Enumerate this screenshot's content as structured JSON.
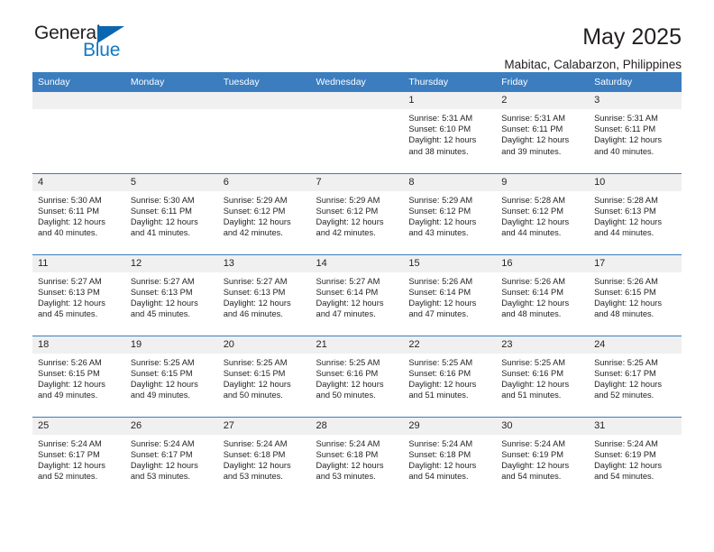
{
  "logo": {
    "word_one": "General",
    "word_two": "Blue",
    "triangle": "blue-triangle-icon",
    "accent": "#1279c1",
    "triangle_color": "#0a66ae"
  },
  "header": {
    "title": "May 2025",
    "subtitle": "Mabitac, Calabarzon, Philippines"
  },
  "theme": {
    "header_band": "#3b7dbf",
    "daynum_band": "#f0f0f0",
    "text": "#231f20"
  },
  "weekdays": [
    "Sunday",
    "Monday",
    "Tuesday",
    "Wednesday",
    "Thursday",
    "Friday",
    "Saturday"
  ],
  "weeks": [
    [
      {
        "day": "",
        "lines": []
      },
      {
        "day": "",
        "lines": []
      },
      {
        "day": "",
        "lines": []
      },
      {
        "day": "",
        "lines": []
      },
      {
        "day": "1",
        "lines": [
          "Sunrise: 5:31 AM",
          "Sunset: 6:10 PM",
          "Daylight: 12 hours",
          "and 38 minutes."
        ]
      },
      {
        "day": "2",
        "lines": [
          "Sunrise: 5:31 AM",
          "Sunset: 6:11 PM",
          "Daylight: 12 hours",
          "and 39 minutes."
        ]
      },
      {
        "day": "3",
        "lines": [
          "Sunrise: 5:31 AM",
          "Sunset: 6:11 PM",
          "Daylight: 12 hours",
          "and 40 minutes."
        ]
      }
    ],
    [
      {
        "day": "4",
        "lines": [
          "Sunrise: 5:30 AM",
          "Sunset: 6:11 PM",
          "Daylight: 12 hours",
          "and 40 minutes."
        ]
      },
      {
        "day": "5",
        "lines": [
          "Sunrise: 5:30 AM",
          "Sunset: 6:11 PM",
          "Daylight: 12 hours",
          "and 41 minutes."
        ]
      },
      {
        "day": "6",
        "lines": [
          "Sunrise: 5:29 AM",
          "Sunset: 6:12 PM",
          "Daylight: 12 hours",
          "and 42 minutes."
        ]
      },
      {
        "day": "7",
        "lines": [
          "Sunrise: 5:29 AM",
          "Sunset: 6:12 PM",
          "Daylight: 12 hours",
          "and 42 minutes."
        ]
      },
      {
        "day": "8",
        "lines": [
          "Sunrise: 5:29 AM",
          "Sunset: 6:12 PM",
          "Daylight: 12 hours",
          "and 43 minutes."
        ]
      },
      {
        "day": "9",
        "lines": [
          "Sunrise: 5:28 AM",
          "Sunset: 6:12 PM",
          "Daylight: 12 hours",
          "and 44 minutes."
        ]
      },
      {
        "day": "10",
        "lines": [
          "Sunrise: 5:28 AM",
          "Sunset: 6:13 PM",
          "Daylight: 12 hours",
          "and 44 minutes."
        ]
      }
    ],
    [
      {
        "day": "11",
        "lines": [
          "Sunrise: 5:27 AM",
          "Sunset: 6:13 PM",
          "Daylight: 12 hours",
          "and 45 minutes."
        ]
      },
      {
        "day": "12",
        "lines": [
          "Sunrise: 5:27 AM",
          "Sunset: 6:13 PM",
          "Daylight: 12 hours",
          "and 45 minutes."
        ]
      },
      {
        "day": "13",
        "lines": [
          "Sunrise: 5:27 AM",
          "Sunset: 6:13 PM",
          "Daylight: 12 hours",
          "and 46 minutes."
        ]
      },
      {
        "day": "14",
        "lines": [
          "Sunrise: 5:27 AM",
          "Sunset: 6:14 PM",
          "Daylight: 12 hours",
          "and 47 minutes."
        ]
      },
      {
        "day": "15",
        "lines": [
          "Sunrise: 5:26 AM",
          "Sunset: 6:14 PM",
          "Daylight: 12 hours",
          "and 47 minutes."
        ]
      },
      {
        "day": "16",
        "lines": [
          "Sunrise: 5:26 AM",
          "Sunset: 6:14 PM",
          "Daylight: 12 hours",
          "and 48 minutes."
        ]
      },
      {
        "day": "17",
        "lines": [
          "Sunrise: 5:26 AM",
          "Sunset: 6:15 PM",
          "Daylight: 12 hours",
          "and 48 minutes."
        ]
      }
    ],
    [
      {
        "day": "18",
        "lines": [
          "Sunrise: 5:26 AM",
          "Sunset: 6:15 PM",
          "Daylight: 12 hours",
          "and 49 minutes."
        ]
      },
      {
        "day": "19",
        "lines": [
          "Sunrise: 5:25 AM",
          "Sunset: 6:15 PM",
          "Daylight: 12 hours",
          "and 49 minutes."
        ]
      },
      {
        "day": "20",
        "lines": [
          "Sunrise: 5:25 AM",
          "Sunset: 6:15 PM",
          "Daylight: 12 hours",
          "and 50 minutes."
        ]
      },
      {
        "day": "21",
        "lines": [
          "Sunrise: 5:25 AM",
          "Sunset: 6:16 PM",
          "Daylight: 12 hours",
          "and 50 minutes."
        ]
      },
      {
        "day": "22",
        "lines": [
          "Sunrise: 5:25 AM",
          "Sunset: 6:16 PM",
          "Daylight: 12 hours",
          "and 51 minutes."
        ]
      },
      {
        "day": "23",
        "lines": [
          "Sunrise: 5:25 AM",
          "Sunset: 6:16 PM",
          "Daylight: 12 hours",
          "and 51 minutes."
        ]
      },
      {
        "day": "24",
        "lines": [
          "Sunrise: 5:25 AM",
          "Sunset: 6:17 PM",
          "Daylight: 12 hours",
          "and 52 minutes."
        ]
      }
    ],
    [
      {
        "day": "25",
        "lines": [
          "Sunrise: 5:24 AM",
          "Sunset: 6:17 PM",
          "Daylight: 12 hours",
          "and 52 minutes."
        ]
      },
      {
        "day": "26",
        "lines": [
          "Sunrise: 5:24 AM",
          "Sunset: 6:17 PM",
          "Daylight: 12 hours",
          "and 53 minutes."
        ]
      },
      {
        "day": "27",
        "lines": [
          "Sunrise: 5:24 AM",
          "Sunset: 6:18 PM",
          "Daylight: 12 hours",
          "and 53 minutes."
        ]
      },
      {
        "day": "28",
        "lines": [
          "Sunrise: 5:24 AM",
          "Sunset: 6:18 PM",
          "Daylight: 12 hours",
          "and 53 minutes."
        ]
      },
      {
        "day": "29",
        "lines": [
          "Sunrise: 5:24 AM",
          "Sunset: 6:18 PM",
          "Daylight: 12 hours",
          "and 54 minutes."
        ]
      },
      {
        "day": "30",
        "lines": [
          "Sunrise: 5:24 AM",
          "Sunset: 6:19 PM",
          "Daylight: 12 hours",
          "and 54 minutes."
        ]
      },
      {
        "day": "31",
        "lines": [
          "Sunrise: 5:24 AM",
          "Sunset: 6:19 PM",
          "Daylight: 12 hours",
          "and 54 minutes."
        ]
      }
    ]
  ]
}
